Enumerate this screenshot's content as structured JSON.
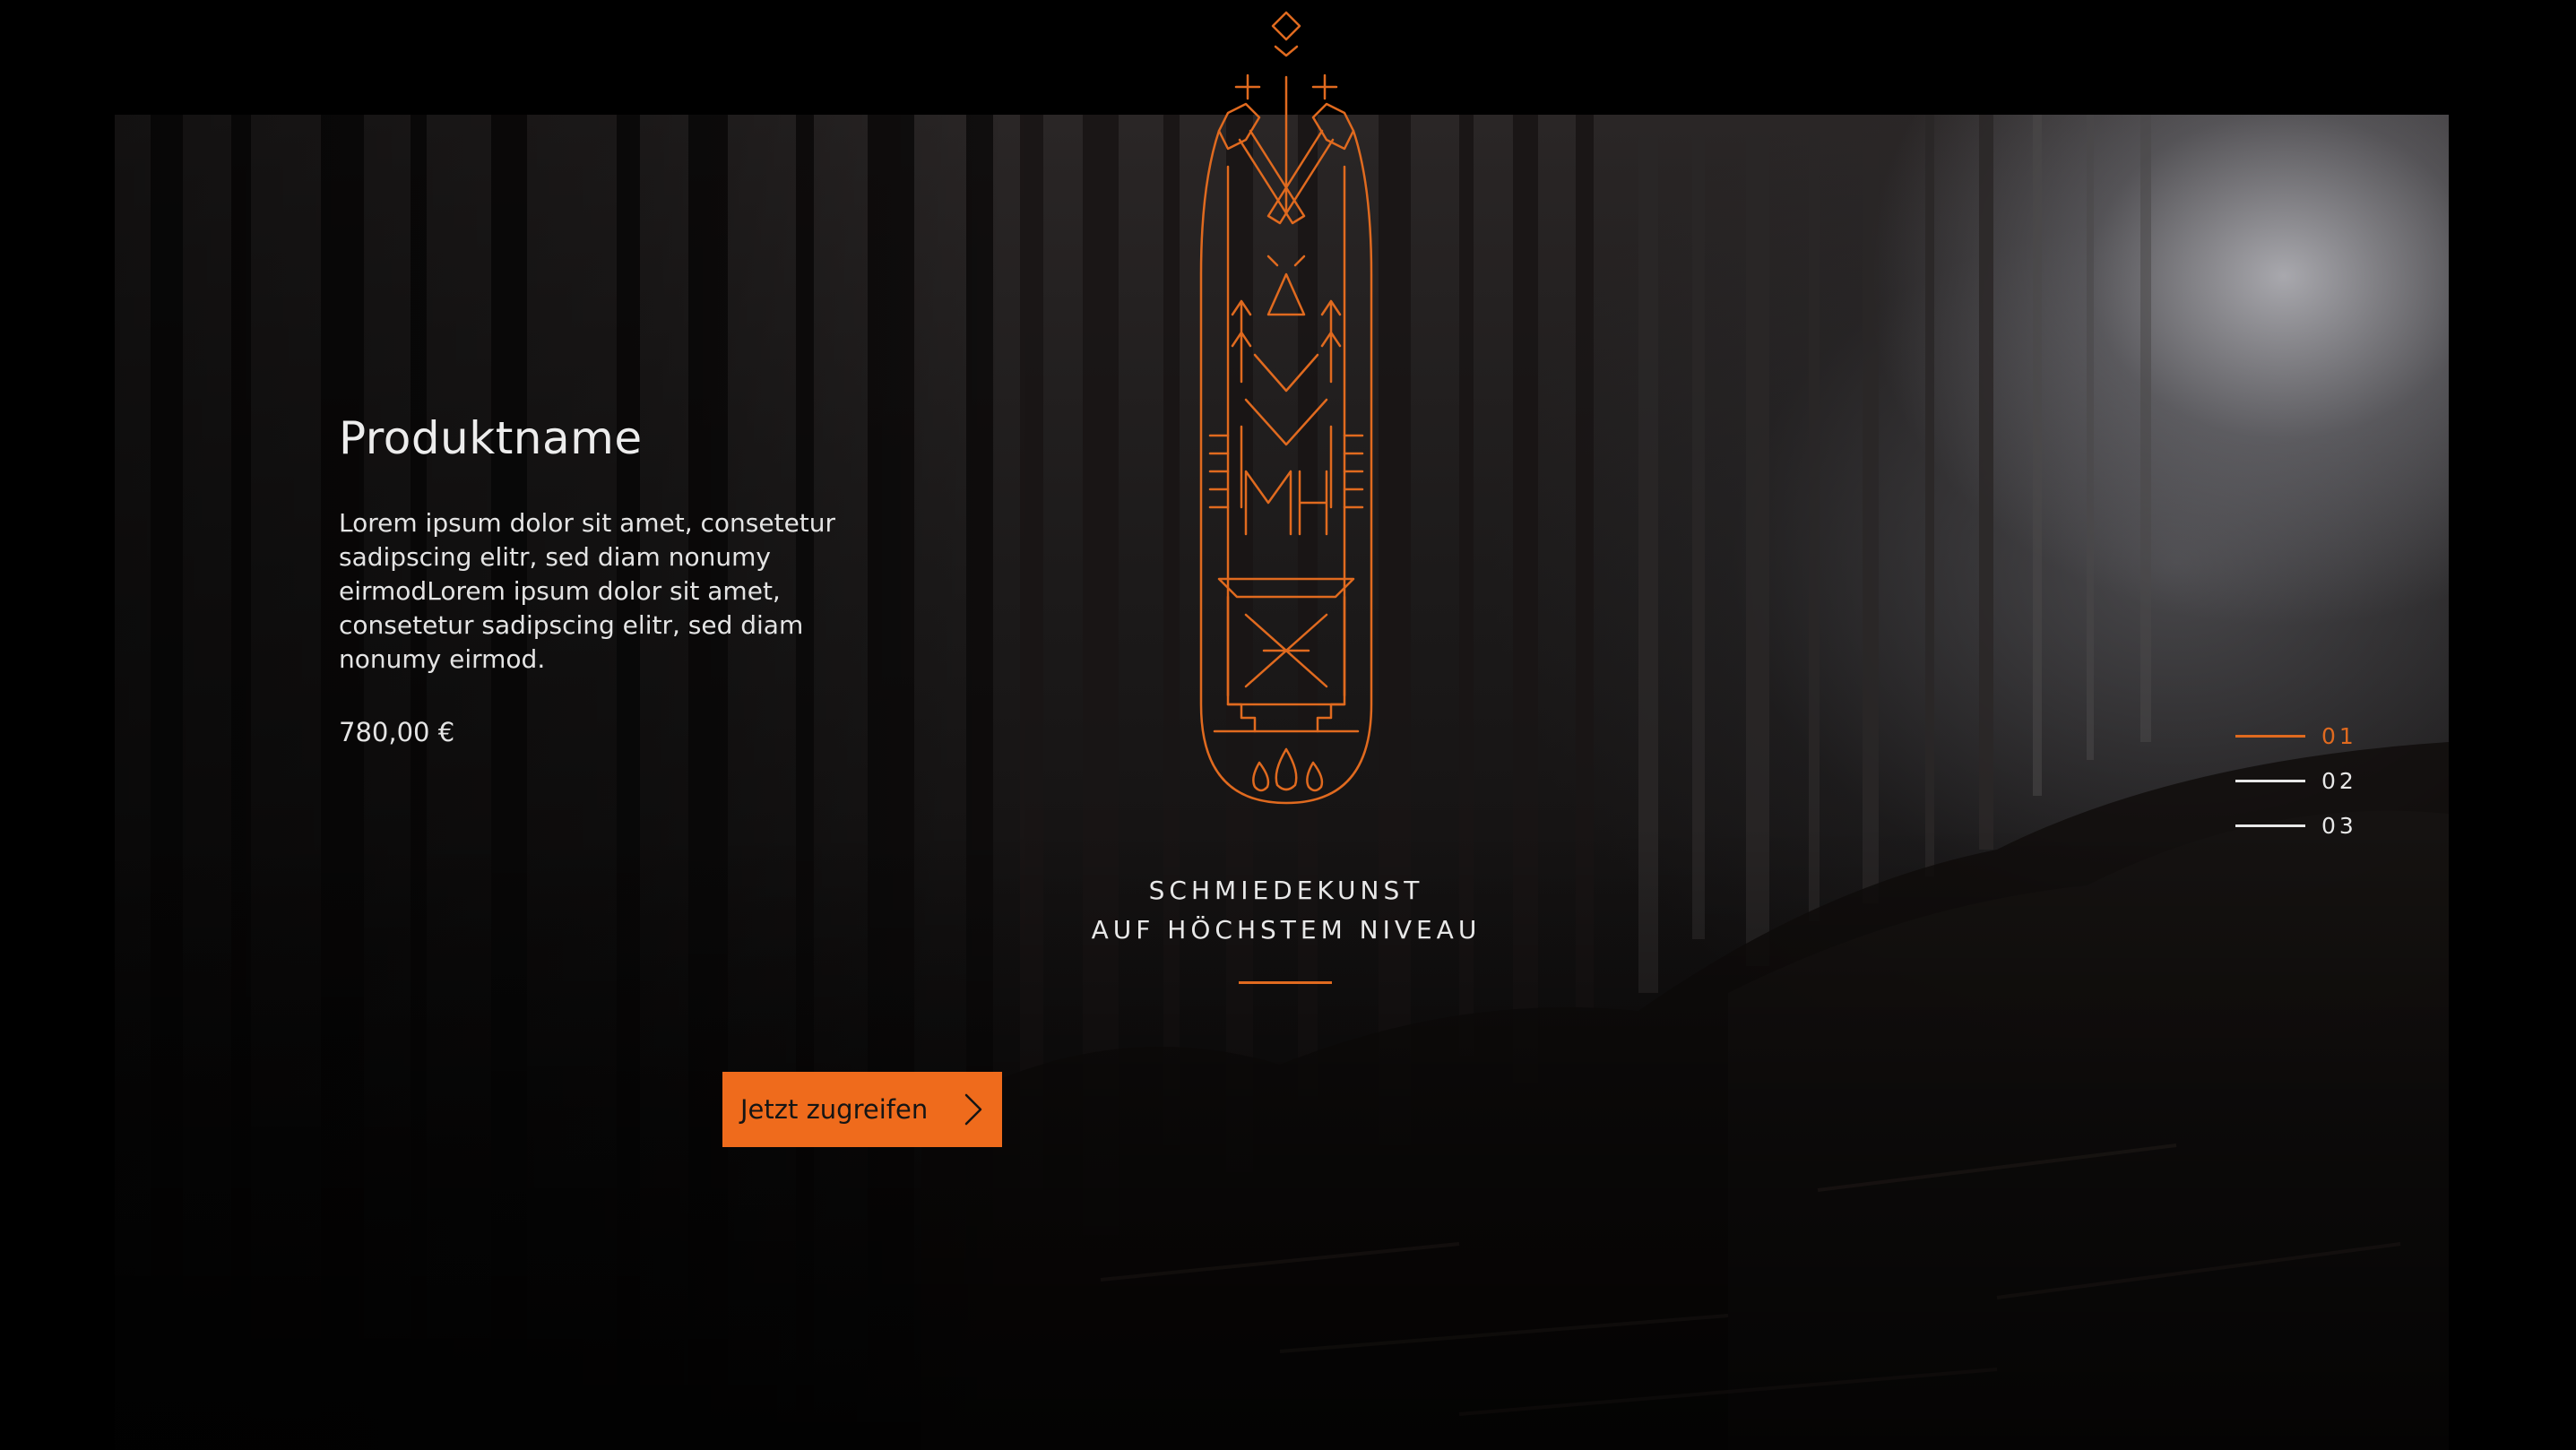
{
  "colors": {
    "accent": "#ef6b1c",
    "background": "#000000",
    "text": "#e8e8e8"
  },
  "product": {
    "name": "Produktname",
    "description": "Lorem ipsum dolor sit amet, consetetur sadipscing elitr, sed diam nonumy eirmodLorem ipsum dolor sit amet, consetetur sadipscing elitr, sed diam nonumy eirmod.",
    "price": "780,00 €"
  },
  "tagline": {
    "line1": "SCHMIEDEKUNST",
    "line2": "AUF HÖCHSTEM NIVEAU"
  },
  "cta": {
    "label": "Jetzt zugreifen",
    "icon": "chevron-right-icon"
  },
  "pager": {
    "items": [
      {
        "label": "01",
        "active": true
      },
      {
        "label": "02",
        "active": false
      },
      {
        "label": "03",
        "active": false
      }
    ]
  },
  "emblem": {
    "icon": "forge-emblem-icon",
    "monogram": "MH"
  }
}
